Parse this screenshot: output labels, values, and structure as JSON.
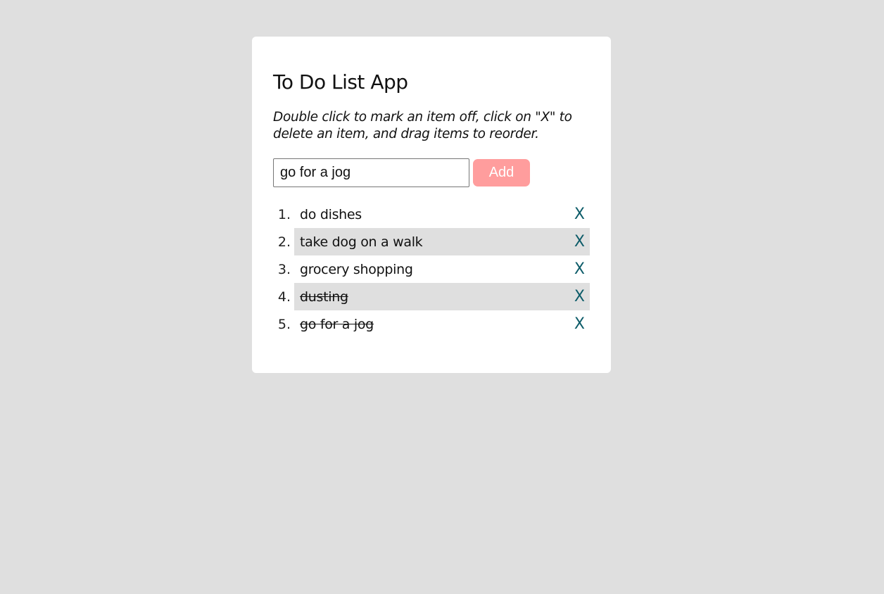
{
  "app": {
    "title": "To Do List App",
    "instructions": "Double click to mark an item off, click on \"X\" to delete an item, and drag items to reorder."
  },
  "form": {
    "input_value": "go for a jog",
    "add_label": "Add"
  },
  "colors": {
    "background": "#dfdfdf",
    "card": "#ffffff",
    "add_button": "#ff9d9d",
    "delete_x": "#0d5c69",
    "alt_row": "#dfdfdf"
  },
  "tasks": [
    {
      "number": "1.",
      "text": "do dishes",
      "completed": false,
      "delete_label": "X"
    },
    {
      "number": "2.",
      "text": "take dog on a walk",
      "completed": false,
      "delete_label": "X"
    },
    {
      "number": "3.",
      "text": "grocery shopping",
      "completed": false,
      "delete_label": "X"
    },
    {
      "number": "4.",
      "text": "dusting",
      "completed": true,
      "delete_label": "X"
    },
    {
      "number": "5.",
      "text": "go for a jog",
      "completed": true,
      "delete_label": "X"
    }
  ]
}
